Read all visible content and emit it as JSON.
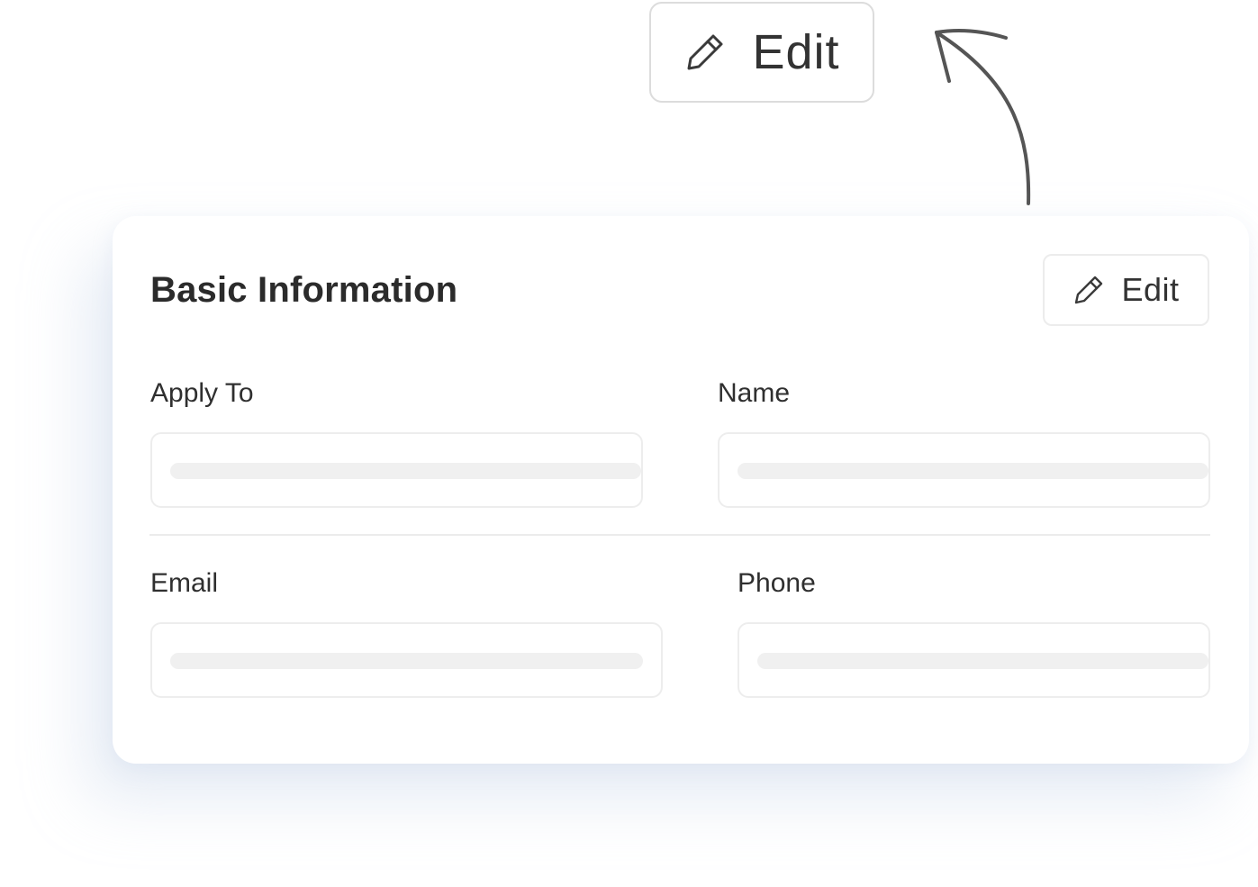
{
  "callout": {
    "edit_label": "Edit",
    "icon": "pencil-icon"
  },
  "card": {
    "title": "Basic Information",
    "edit_label": "Edit",
    "edit_icon": "pencil-icon",
    "fields": [
      {
        "label": "Apply To",
        "value": ""
      },
      {
        "label": "Name",
        "value": ""
      },
      {
        "label": "Email",
        "value": ""
      },
      {
        "label": "Phone",
        "value": ""
      }
    ]
  },
  "colors": {
    "text": "#2b2b2b",
    "border": "#ececec",
    "skeleton": "#f0f0f0",
    "arrow": "#555555"
  }
}
